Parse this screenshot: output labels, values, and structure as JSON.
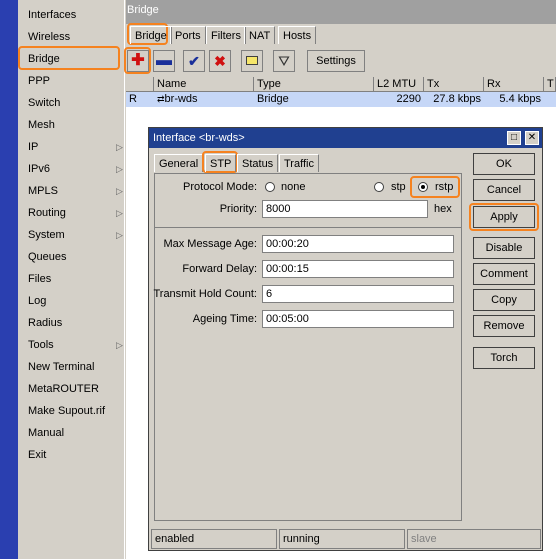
{
  "menu": {
    "items": [
      {
        "label": "Interfaces",
        "submenu": false
      },
      {
        "label": "Wireless",
        "submenu": false
      },
      {
        "label": "Bridge",
        "submenu": false
      },
      {
        "label": "PPP",
        "submenu": false
      },
      {
        "label": "Switch",
        "submenu": false
      },
      {
        "label": "Mesh",
        "submenu": false
      },
      {
        "label": "IP",
        "submenu": true
      },
      {
        "label": "IPv6",
        "submenu": true
      },
      {
        "label": "MPLS",
        "submenu": true
      },
      {
        "label": "Routing",
        "submenu": true
      },
      {
        "label": "System",
        "submenu": true
      },
      {
        "label": "Queues",
        "submenu": false
      },
      {
        "label": "Files",
        "submenu": false
      },
      {
        "label": "Log",
        "submenu": false
      },
      {
        "label": "Radius",
        "submenu": false
      },
      {
        "label": "Tools",
        "submenu": true
      },
      {
        "label": "New Terminal",
        "submenu": false
      },
      {
        "label": "MetaROUTER",
        "submenu": false
      },
      {
        "label": "Make Supout.rif",
        "submenu": false
      },
      {
        "label": "Manual",
        "submenu": false
      },
      {
        "label": "Exit",
        "submenu": false
      }
    ]
  },
  "window": {
    "title": "Bridge"
  },
  "tabs": [
    "Bridge",
    "Ports",
    "Filters",
    "NAT",
    "Hosts"
  ],
  "toolbar": {
    "settings_label": "Settings"
  },
  "grid": {
    "headers": [
      "Name",
      "Type",
      "L2 MTU",
      "Tx",
      "Rx",
      "T"
    ],
    "row": {
      "flag": "R",
      "name": "br-wds",
      "type": "Bridge",
      "l2mtu": "2290",
      "tx": "27.8 kbps",
      "rx": "5.4 kbps"
    }
  },
  "dialog": {
    "title": "Interface <br-wds>",
    "tabs": [
      "General",
      "STP",
      "Status",
      "Traffic"
    ],
    "protocol_mode_label": "Protocol Mode:",
    "protocol_options": [
      "none",
      "stp",
      "rstp"
    ],
    "priority_label": "Priority:",
    "priority_value": "8000",
    "priority_unit": "hex",
    "max_message_age_label": "Max Message Age:",
    "max_message_age_value": "00:00:20",
    "forward_delay_label": "Forward Delay:",
    "forward_delay_value": "00:00:15",
    "transmit_hold_label": "Transmit Hold Count:",
    "transmit_hold_value": "6",
    "ageing_time_label": "Ageing Time:",
    "ageing_time_value": "00:05:00",
    "buttons": [
      "OK",
      "Cancel",
      "Apply",
      "Disable",
      "Comment",
      "Copy",
      "Remove",
      "Torch"
    ]
  },
  "statusbar": [
    "enabled",
    "running",
    "slave"
  ],
  "colors": {
    "sidebar": "#2a3fb0",
    "highlight": "#f5821f",
    "selected_row": "#c6d7f7",
    "dialog_title": "#204090"
  }
}
